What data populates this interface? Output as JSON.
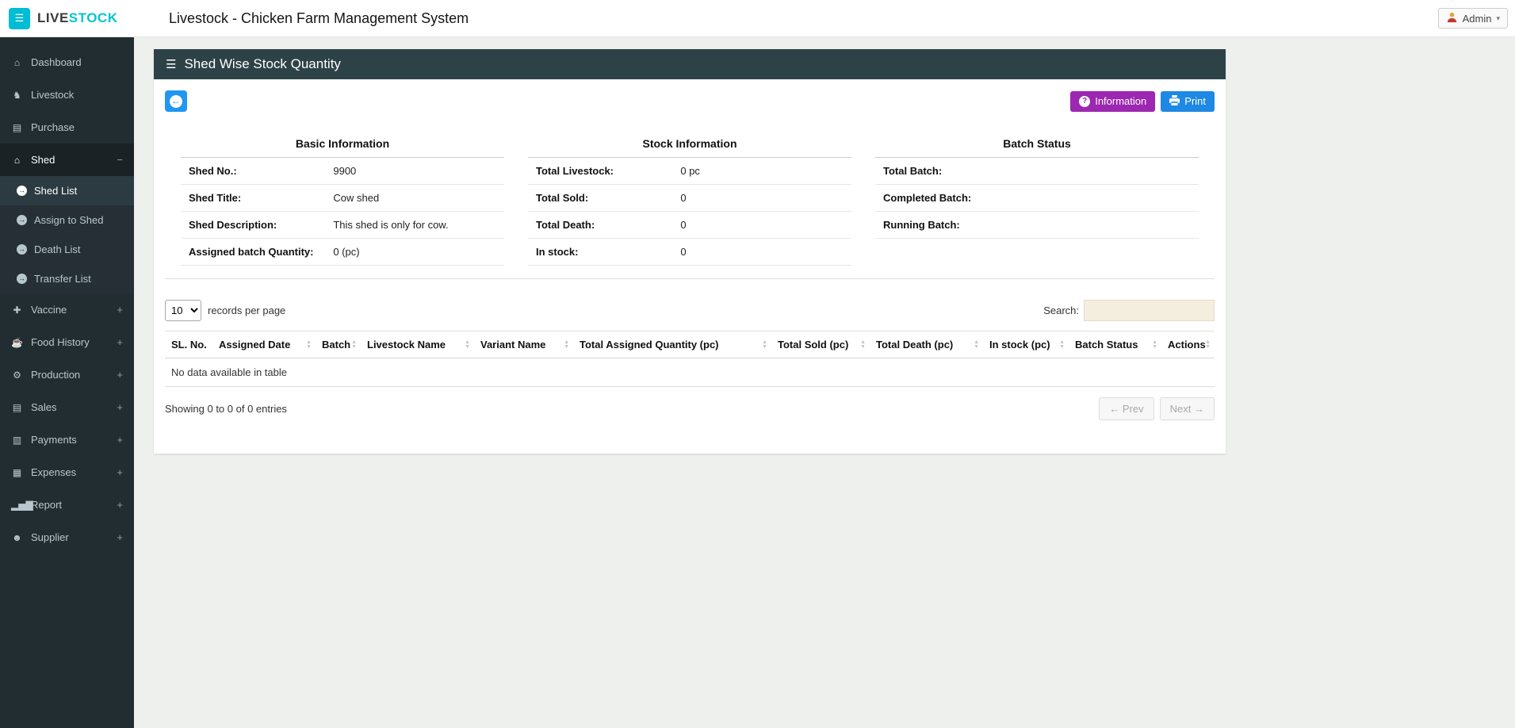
{
  "header": {
    "hamburger": "☰",
    "logo_prefix": "LIVE",
    "logo_suffix": "STOCK",
    "title": "Livestock - Chicken Farm Management System",
    "user": "Admin",
    "caret": "▾"
  },
  "sidebar": {
    "items": [
      {
        "label": "Dashboard",
        "icon": "⌂"
      },
      {
        "label": "Livestock",
        "icon": "♞"
      },
      {
        "label": "Purchase",
        "icon": "▤"
      },
      {
        "label": "Shed",
        "icon": "⌂",
        "state": "−",
        "children": [
          {
            "label": "Shed List",
            "icon": "→"
          },
          {
            "label": "Assign to Shed",
            "icon": "→"
          },
          {
            "label": "Death List",
            "icon": "→"
          },
          {
            "label": "Transfer List",
            "icon": "→"
          }
        ]
      },
      {
        "label": "Vaccine",
        "icon": "✚",
        "state": "+"
      },
      {
        "label": "Food History",
        "icon": "☕",
        "state": "+"
      },
      {
        "label": "Production",
        "icon": "⚙",
        "state": "+"
      },
      {
        "label": "Sales",
        "icon": "▤",
        "state": "+"
      },
      {
        "label": "Payments",
        "icon": "▥",
        "state": "+"
      },
      {
        "label": "Expenses",
        "icon": "▦",
        "state": "+"
      },
      {
        "label": "Report",
        "icon": "▂▅▇",
        "state": "+"
      },
      {
        "label": "Supplier",
        "icon": "☻",
        "state": "+"
      }
    ]
  },
  "panel": {
    "title": "Shed Wise Stock Quantity",
    "title_icon": "☰",
    "back_icon": "←",
    "info_button": "Information",
    "info_icon": "?",
    "print_button": "Print",
    "info": {
      "columns": [
        {
          "heading": "Basic Information",
          "rows": [
            {
              "label": "Shed No.:",
              "value": "9900"
            },
            {
              "label": "Shed Title:",
              "value": "Cow shed"
            },
            {
              "label": "Shed Description:",
              "value": "This shed is only for cow."
            },
            {
              "label": "Assigned batch Quantity:",
              "value": "0 (pc)"
            }
          ]
        },
        {
          "heading": "Stock Information",
          "rows": [
            {
              "label": "Total Livestock:",
              "value": "0 pc"
            },
            {
              "label": "Total Sold:",
              "value": "0"
            },
            {
              "label": "Total Death:",
              "value": "0"
            },
            {
              "label": "In stock:",
              "value": "0"
            }
          ]
        },
        {
          "heading": "Batch Status",
          "rows": [
            {
              "label": "Total Batch:",
              "value": ""
            },
            {
              "label": "Completed Batch:",
              "value": ""
            },
            {
              "label": "Running Batch:",
              "value": ""
            }
          ]
        }
      ]
    },
    "table": {
      "length_value": "10",
      "length_label": "records per page",
      "search_label": "Search:",
      "columns": [
        "SL. No.",
        "Assigned Date",
        "Batch",
        "Livestock Name",
        "Variant Name",
        "Total Assigned Quantity (pc)",
        "Total Sold (pc)",
        "Total Death (pc)",
        "In stock (pc)",
        "Batch Status",
        "Actions"
      ],
      "sort_asc": "▲",
      "sort_desc": "▼",
      "empty_text": "No data available in table",
      "info_text": "Showing 0 to 0 of 0 entries",
      "prev": "← Prev",
      "next": "Next →"
    },
    "colors": {
      "accent_cyan": "#00bcd4",
      "panel_header": "#2d4247",
      "info_button": "#9c27b0",
      "print_button": "#1e88e5",
      "sidebar_bg": "#222d32"
    }
  }
}
